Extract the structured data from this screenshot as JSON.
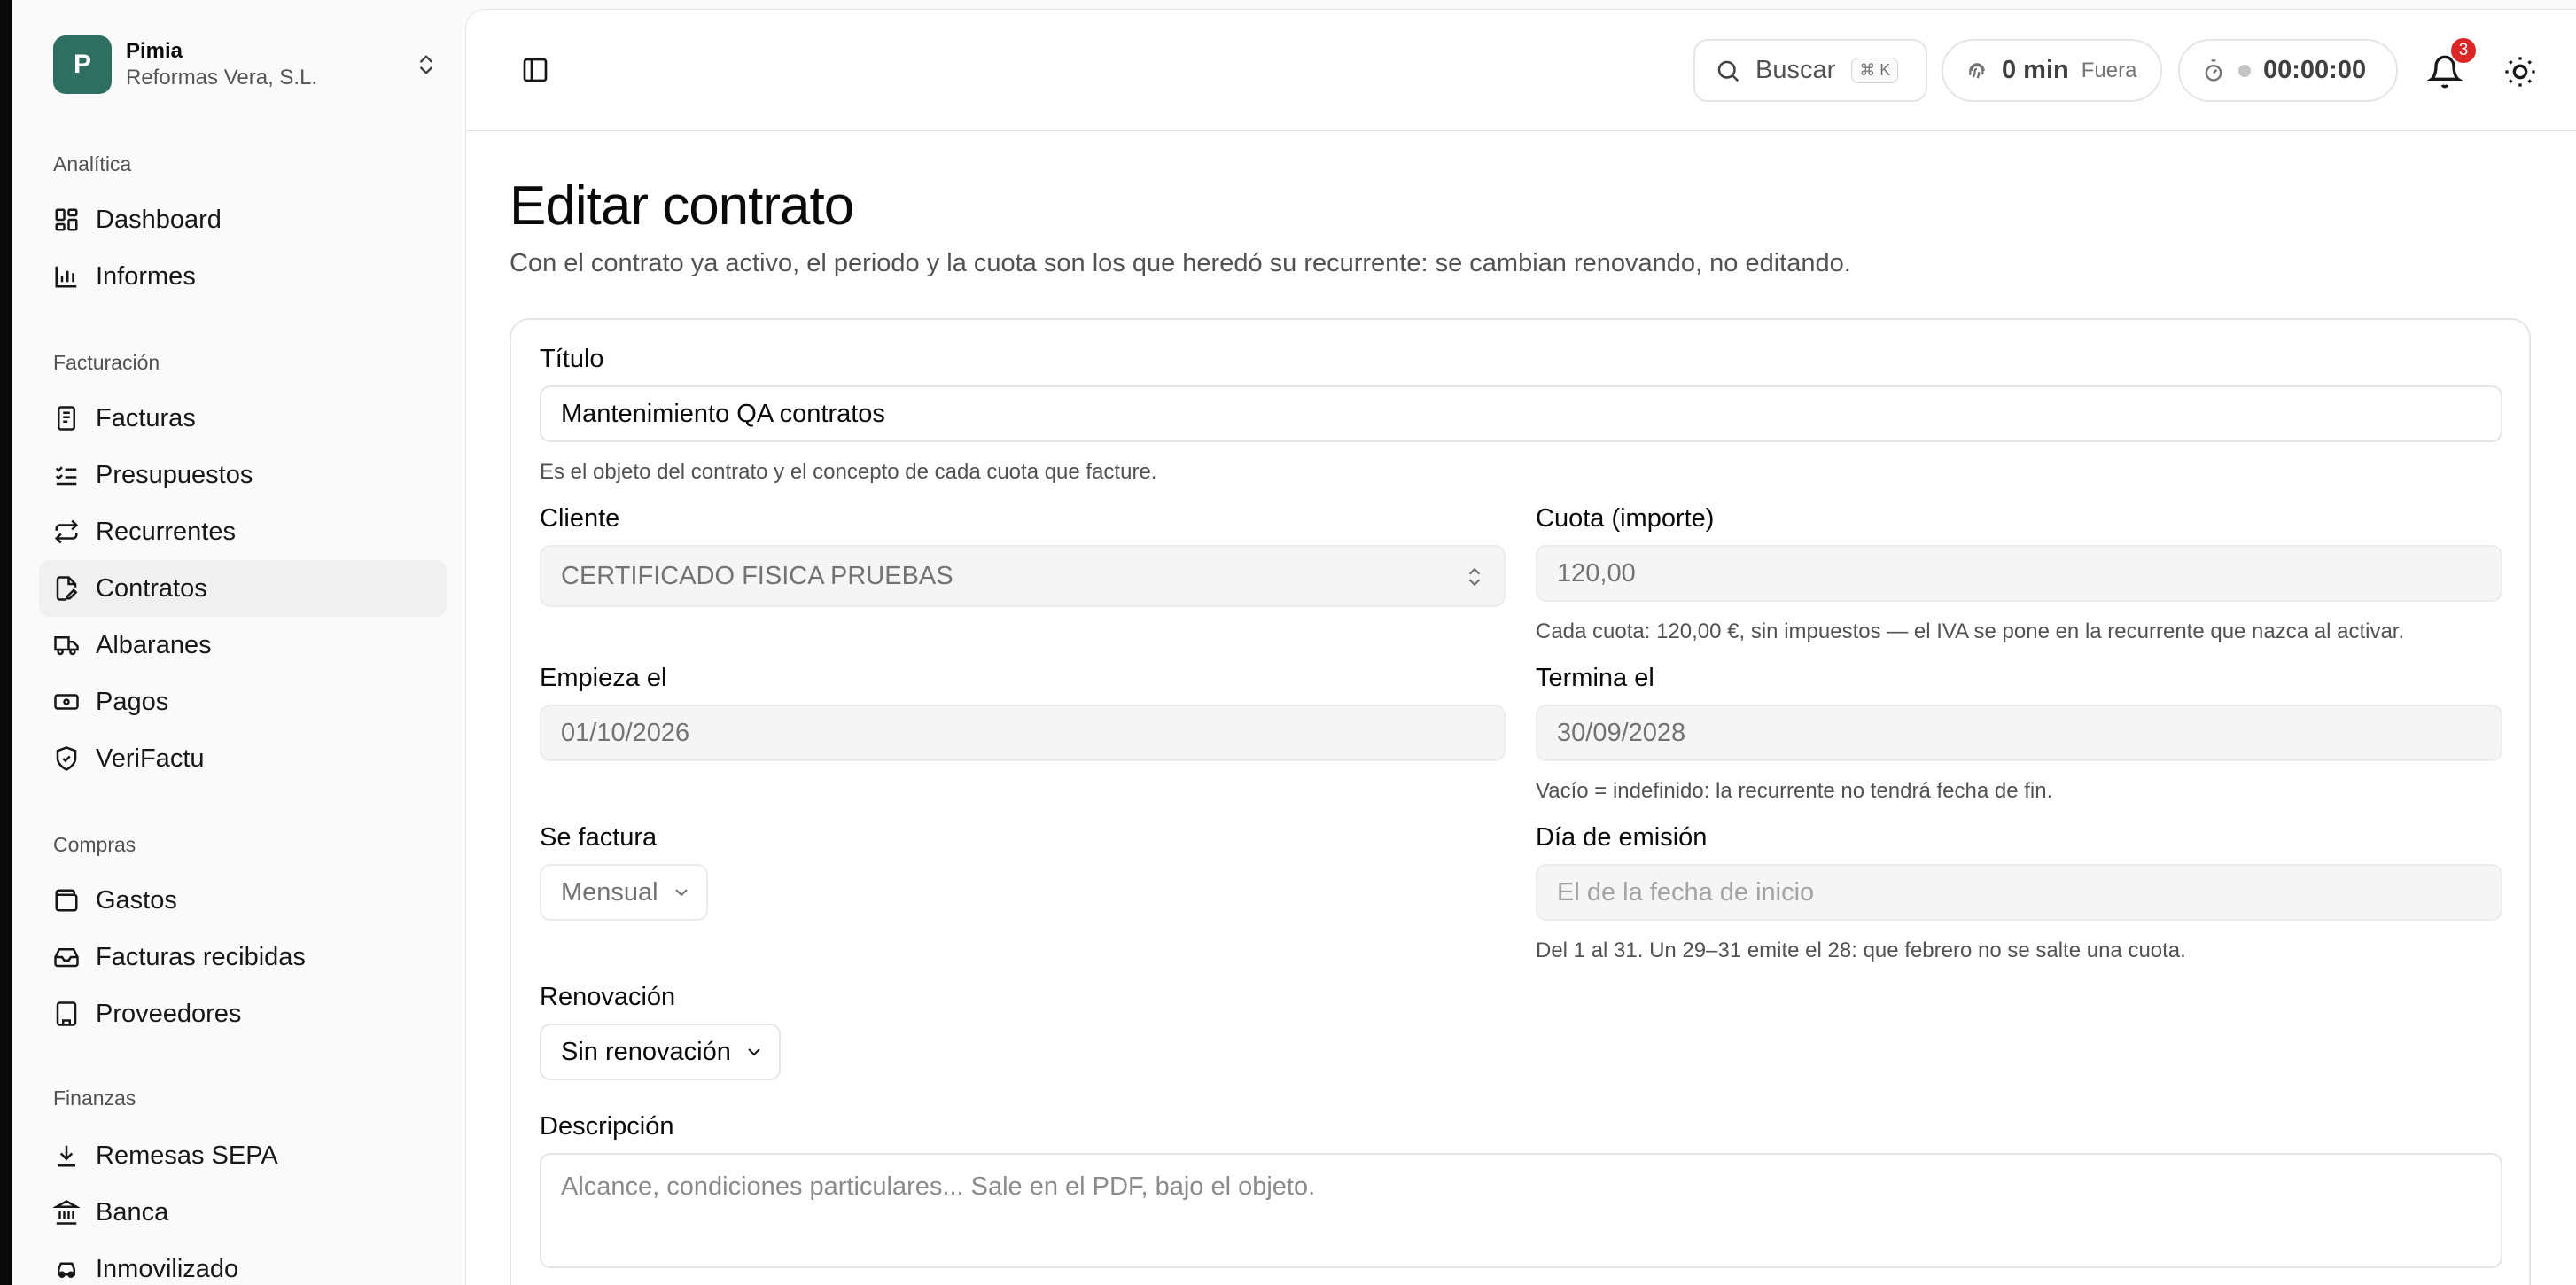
{
  "org": {
    "initial": "P",
    "name": "Pimia",
    "company": "Reformas Vera, S.L."
  },
  "sidebar": {
    "groups": [
      {
        "label": "Analítica",
        "items": [
          {
            "label": "Dashboard",
            "icon": "dashboard-icon"
          },
          {
            "label": "Informes",
            "icon": "bar-chart-icon"
          }
        ]
      },
      {
        "label": "Facturación",
        "items": [
          {
            "label": "Facturas",
            "icon": "receipt-icon"
          },
          {
            "label": "Presupuestos",
            "icon": "list-check-icon"
          },
          {
            "label": "Recurrentes",
            "icon": "repeat-icon"
          },
          {
            "label": "Contratos",
            "icon": "file-pen-icon",
            "active": true
          },
          {
            "label": "Albaranes",
            "icon": "truck-icon"
          },
          {
            "label": "Pagos",
            "icon": "banknote-icon"
          },
          {
            "label": "VeriFactu",
            "icon": "shield-check-icon"
          }
        ]
      },
      {
        "label": "Compras",
        "items": [
          {
            "label": "Gastos",
            "icon": "wallet-icon"
          },
          {
            "label": "Facturas recibidas",
            "icon": "inbox-icon"
          },
          {
            "label": "Proveedores",
            "icon": "building-icon"
          }
        ]
      },
      {
        "label": "Finanzas",
        "items": [
          {
            "label": "Remesas SEPA",
            "icon": "download-icon"
          },
          {
            "label": "Banca",
            "icon": "landmark-icon"
          },
          {
            "label": "Inmovilizado",
            "icon": "car-icon"
          }
        ]
      }
    ]
  },
  "topbar": {
    "search_label": "Buscar",
    "search_shortcut": "⌘ K",
    "time_value": "0 min",
    "time_status": "Fuera",
    "timer": "00:00:00",
    "notifications_count": "3"
  },
  "page": {
    "title": "Editar contrato",
    "subtitle": "Con el contrato ya activo, el periodo y la cuota son los que heredó su recurrente: se cambian renovando, no editando."
  },
  "form": {
    "titulo_label": "Título",
    "titulo_value": "Mantenimiento QA contratos",
    "titulo_help": "Es el objeto del contrato y el concepto de cada cuota que facture.",
    "cliente_label": "Cliente",
    "cliente_value": "CERTIFICADO FISICA PRUEBAS",
    "cuota_label": "Cuota (importe)",
    "cuota_value": "120,00",
    "cuota_help": "Cada cuota: 120,00 €, sin impuestos — el IVA se pone en la recurrente que nazca al activar.",
    "empieza_label": "Empieza el",
    "empieza_value": "01/10/2026",
    "termina_label": "Termina el",
    "termina_value": "30/09/2028",
    "termina_help": "Vacío = indefinido: la recurrente no tendrá fecha de fin.",
    "factura_label": "Se factura",
    "factura_value": "Mensual",
    "dia_label": "Día de emisión",
    "dia_placeholder": "El de la fecha de inicio",
    "dia_help": "Del 1 al 31. Un 29–31 emite el 28: que febrero no se salte una cuota.",
    "renovacion_label": "Renovación",
    "renovacion_value": "Sin renovación",
    "descripcion_label": "Descripción",
    "descripcion_placeholder": "Alcance, condiciones particulares... Sale en el PDF, bajo el objeto."
  },
  "colors": {
    "accent": "#2f6f62",
    "badge": "#dc2626"
  }
}
